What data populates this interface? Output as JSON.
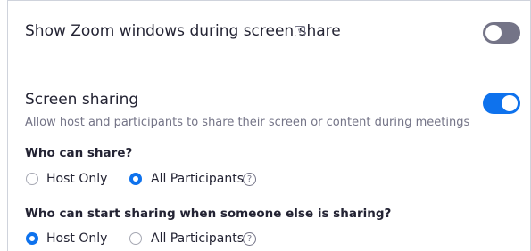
{
  "zoom_windows": {
    "title": "Show Zoom windows during screen share",
    "info_icon": "v-badge-icon",
    "toggle_on": false
  },
  "screen_sharing": {
    "title": "Screen sharing",
    "description": "Allow host and participants to share their screen or content during meetings",
    "toggle_on": true
  },
  "who_can_share": {
    "label": "Who can share?",
    "options": [
      {
        "label": "Host Only",
        "selected": false
      },
      {
        "label": "All Participants",
        "selected": true
      }
    ],
    "help_icon": "question-icon",
    "help_glyph": "?"
  },
  "who_can_start": {
    "label": "Who can start sharing when someone else is sharing?",
    "options": [
      {
        "label": "Host Only",
        "selected": true
      },
      {
        "label": "All Participants",
        "selected": false
      }
    ],
    "help_icon": "question-icon",
    "help_glyph": "?"
  },
  "colors": {
    "accent": "#0e72ed",
    "toggle_off": "#747487",
    "text": "#232333",
    "muted": "#747487"
  }
}
